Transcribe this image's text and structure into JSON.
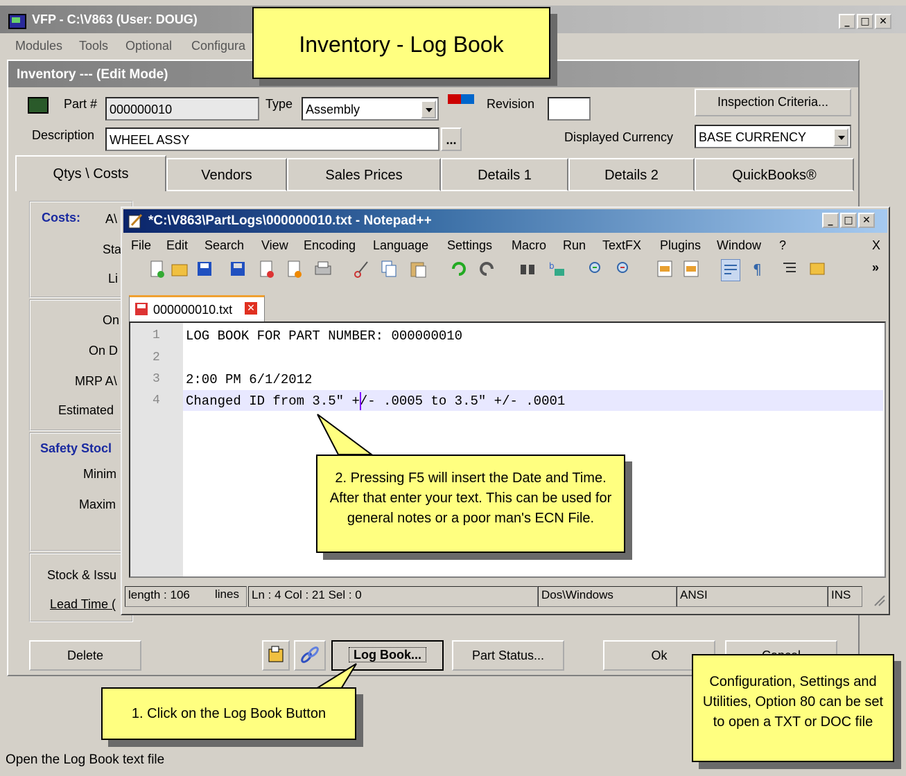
{
  "vfp": {
    "title": "VFP - C:\\V863  (User: DOUG)",
    "menu": [
      "Modules",
      "Tools",
      "Optional",
      "Configura"
    ]
  },
  "inventory": {
    "title": "Inventory --- (Edit Mode)",
    "part_label": "Part #",
    "part_value": "000000010",
    "type_label": "Type",
    "type_value": "Assembly",
    "revision_label": "Revision",
    "revision_value": "",
    "inspection_button": "Inspection Criteria...",
    "description_label": "Description",
    "description_value": "WHEEL ASSY",
    "ellipsis_button": "...",
    "currency_label": "Displayed Currency",
    "currency_value": "BASE CURRENCY",
    "tabs": [
      "Qtys \\ Costs",
      "Vendors",
      "Sales Prices",
      "Details 1",
      "Details 2",
      "QuickBooks®"
    ],
    "left_labels": {
      "costs": "Costs:",
      "costs_av": "A\\",
      "sta": "Sta",
      "li": "Li",
      "on": "On",
      "on_d": "On D",
      "mrp": "MRP A\\",
      "estimated": "Estimated",
      "safety": "Safety Stocl",
      "minim": "Minim",
      "maxim": "Maxim",
      "stock_issue": "Stock & Issu",
      "lead_time": "Lead Time ("
    },
    "buttons": {
      "delete": "Delete",
      "log_book": "Log Book...",
      "part_status": "Part Status...",
      "ok": "Ok",
      "cancel": "Cancel"
    }
  },
  "banner": {
    "title": "Inventory - Log Book"
  },
  "notepad": {
    "title": "*C:\\V863\\PartLogs\\000000010.txt - Notepad++",
    "menu": [
      "File",
      "Edit",
      "Search",
      "View",
      "Encoding",
      "Language",
      "Settings",
      "Macro",
      "Run",
      "TextFX",
      "Plugins",
      "Window",
      "?"
    ],
    "menu_close": "X",
    "toolbar_more": "»",
    "tab_label": "000000010.txt",
    "line_numbers": [
      "1",
      "2",
      "3",
      "4"
    ],
    "lines": [
      "LOG BOOK FOR PART NUMBER: 000000010",
      "",
      "2:00 PM 6/1/2012",
      "Changed ID from 3.5\" +/- .0005 to 3.5\" +/- .0001"
    ],
    "status": {
      "length": "length : 106",
      "lines": "lines",
      "pos": "Ln : 4    Col : 21    Sel : 0",
      "eol": "Dos\\Windows",
      "encoding": "ANSI",
      "mode": "INS"
    }
  },
  "callouts": {
    "step1": "1. Click on the Log Book Button",
    "step2": "2. Pressing F5 will insert the Date and Time.  After that enter your text.  This can be used for general notes or a poor man's ECN File.",
    "config": "Configuration, Settings and Utilities, Option 80 can be set to open a TXT or DOC file"
  },
  "status_bar": "Open the Log Book text file",
  "colors": {
    "callout": "#ffff80",
    "label_blue": "#1a2aa0",
    "npp_title": "#0a246a"
  },
  "icons": [
    "application-icon",
    "notepad-icon",
    "close-tab-icon",
    "save-icon",
    "open-icon",
    "print-icon",
    "cut-icon",
    "copy-icon",
    "paste-icon",
    "undo-icon",
    "redo-icon",
    "find-icon",
    "replace-icon",
    "zoom-in-icon",
    "zoom-out-icon",
    "wrap-icon",
    "pilcrow-icon",
    "indent-guide-icon",
    "hyperlink-icon",
    "folder-icon"
  ]
}
